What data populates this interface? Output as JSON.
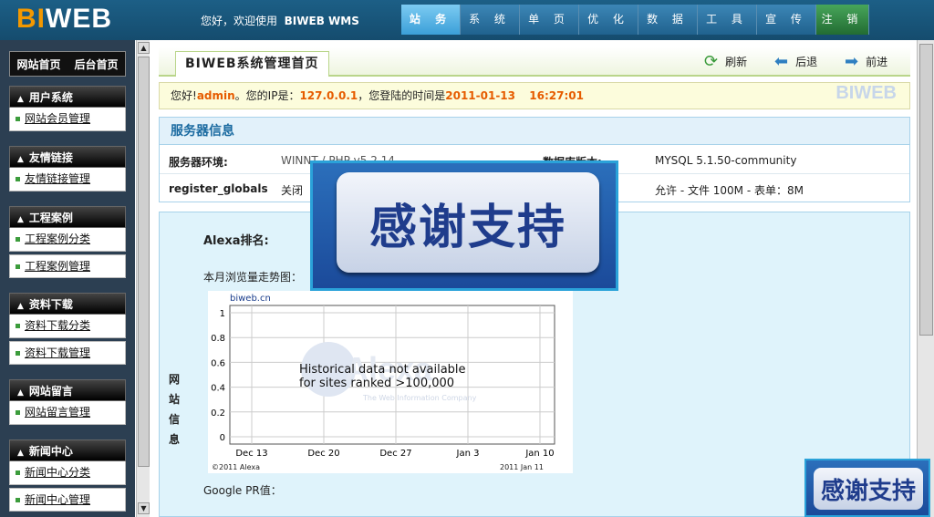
{
  "header": {
    "logo_a": "BI",
    "logo_b": "WEB",
    "welcome_prefix": "您好，欢迎使用",
    "welcome_product": "BIWEB WMS",
    "nav": [
      "站 务",
      "系 统",
      "单 页",
      "优 化",
      "数 据",
      "工 具",
      "宣 传",
      "注 销"
    ]
  },
  "sidebar": {
    "home_site": "网站首页",
    "home_admin": "后台首页",
    "groups": [
      {
        "title": "用户系统",
        "items": [
          "网站会员管理"
        ]
      },
      {
        "title": "友情链接",
        "items": [
          "友情链接管理"
        ]
      },
      {
        "title": "工程案例",
        "items": [
          "工程案例分类",
          "工程案例管理"
        ]
      },
      {
        "title": "资料下载",
        "items": [
          "资料下载分类",
          "资料下载管理"
        ]
      },
      {
        "title": "网站留言",
        "items": [
          "网站留言管理"
        ]
      },
      {
        "title": "新闻中心",
        "items": [
          "新闻中心分类",
          "新闻中心管理"
        ]
      }
    ]
  },
  "toolbar": {
    "page_title": "BIWEB系统管理首页",
    "refresh": "刷新",
    "back": "后退",
    "forward": "前进"
  },
  "info": {
    "hello": "您好!",
    "user": "admin",
    "ip_label": "。您的IP是：",
    "ip": "127.0.0.1",
    "time_label": "，您登陆的时间是",
    "date": "2011-01-13",
    "time": "16:27:01",
    "brand": "BIWEB"
  },
  "server": {
    "title": "服务器信息",
    "env_label": "服务器环境:",
    "env_value": "WINNT / PHP v5.2.14",
    "db_label": "数据库版本:",
    "db_value": "MYSQL 5.1.50-community",
    "globals_label": "register_globals",
    "globals_value": "关闭",
    "upload_value": "允许 - 文件 100M - 表单：8M"
  },
  "site": {
    "label": "网站信息",
    "alexa_label": "Alexa排名:",
    "trend_label": "本月浏览量走势图：",
    "pr_label": "Google PR值："
  },
  "chart_data": {
    "type": "line",
    "title": "biweb.cn",
    "categories": [
      "Dec 13",
      "Dec 20",
      "Dec 27",
      "Jan 3",
      "Jan 10"
    ],
    "yticks": [
      "1",
      "0.8",
      "0.6",
      "0.4",
      "0.2",
      "0"
    ],
    "ylim": [
      0,
      1
    ],
    "message_1": "Historical data not available",
    "message_2": "for sites ranked >100,000",
    "watermark": "Alexa",
    "watermark_sub": "The Web Information Company",
    "footer_left": "©2011 Alexa",
    "footer_right": "2011 Jan 11",
    "grid": true
  },
  "overlay": {
    "text": "感谢支持",
    "badge": "感谢支持"
  }
}
